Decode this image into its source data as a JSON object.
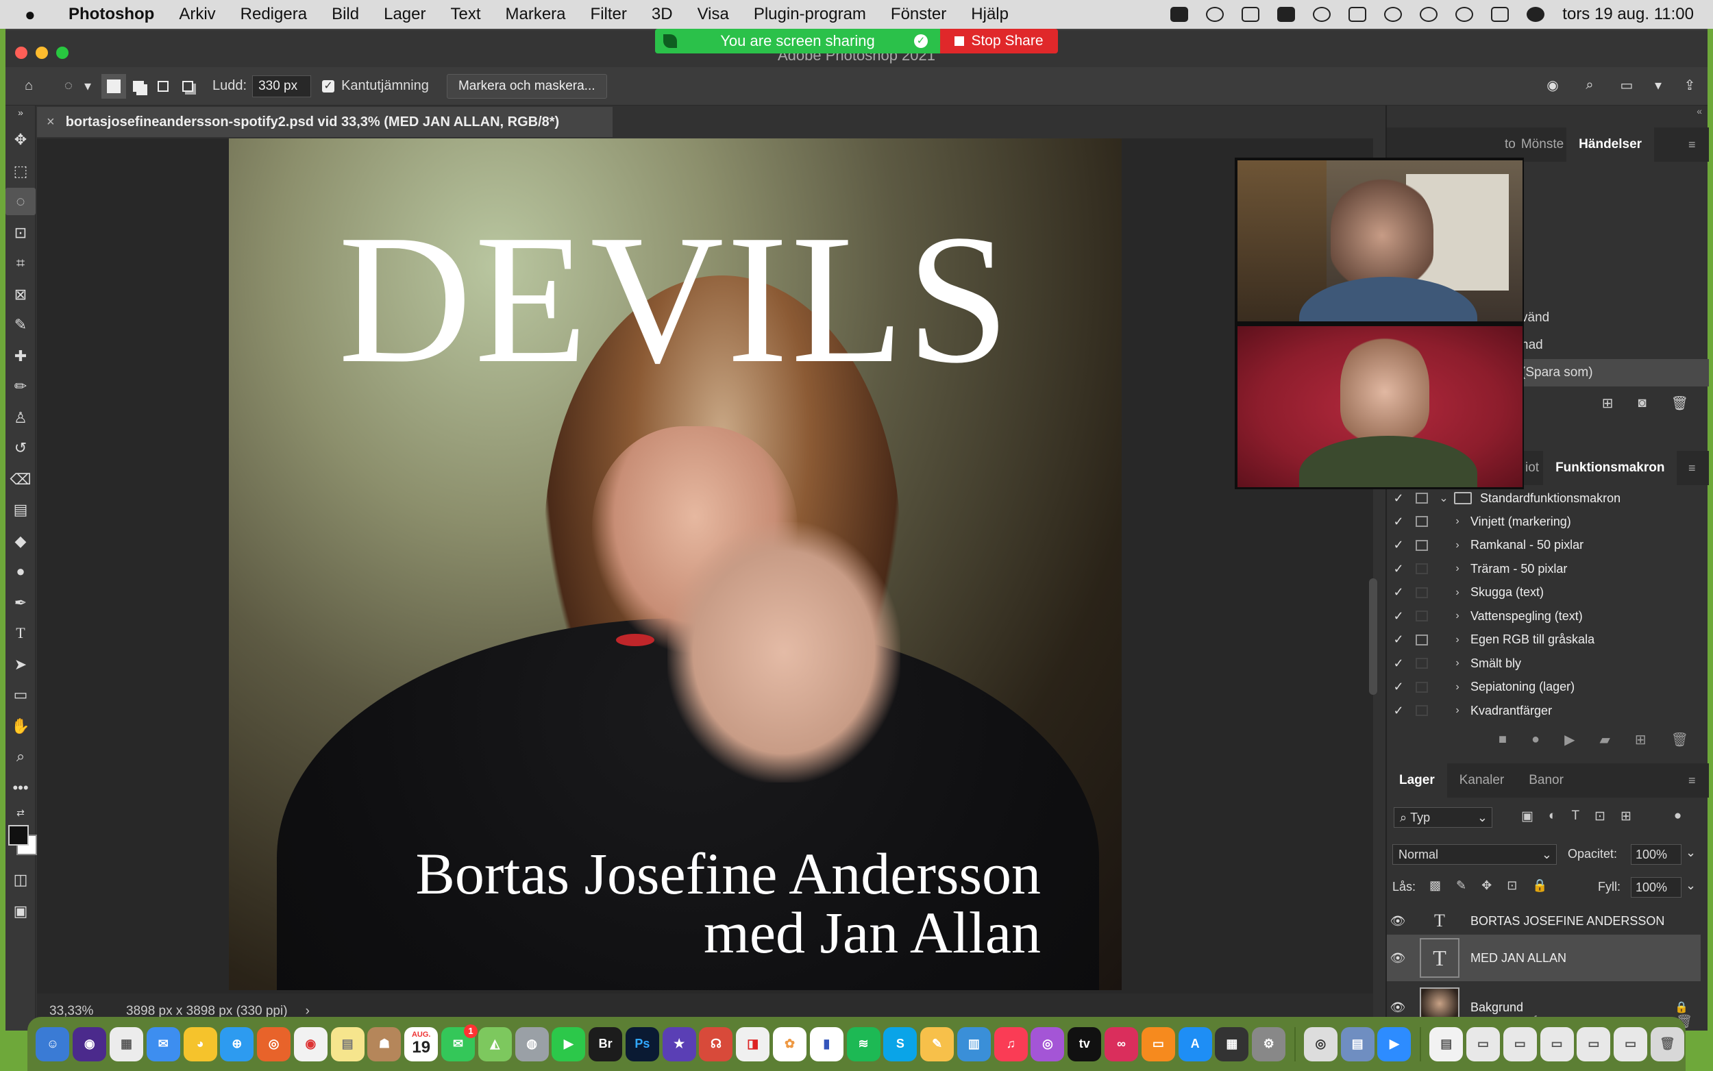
{
  "menubar": {
    "app_name": "Photoshop",
    "items": [
      "Arkiv",
      "Redigera",
      "Bild",
      "Lager",
      "Text",
      "Markera",
      "Filter",
      "3D",
      "Visa",
      "Plugin-program",
      "Fönster",
      "Hjälp"
    ],
    "clock": "tors 19 aug.  11:00"
  },
  "window": {
    "title": "Adobe Photoshop 2021"
  },
  "screenshare": {
    "status_text": "You are screen sharing",
    "stop_label": "Stop Share"
  },
  "options": {
    "feather_label": "Ludd:",
    "feather_value": "330 px",
    "antialias_label": "Kantutjämning",
    "antialias_checked": true,
    "select_mask_label": "Markera och maskera..."
  },
  "document": {
    "tab_title": "bortasjosefineandersson-spotify2.psd vid 33,3% (MED JAN ALLAN, RGB/8*)",
    "close_glyph": "×",
    "zoom": "33,33%",
    "size_info": "3898 px x 3898 px (330 ppi)"
  },
  "artwork": {
    "title": "DEVILS",
    "line1": "Bortas Josefine Andersson",
    "line2": "med Jan Allan"
  },
  "history_panel": {
    "tabs": [
      "to",
      "Mönste",
      "Händelser"
    ],
    "active_tab": "Händelser",
    "rows": [
      "vänd",
      "nad",
      "(Spara som)"
    ]
  },
  "actions_panel": {
    "tabs": [
      "iot",
      "Funktionsmakron"
    ],
    "active_tab": "Funktionsmakron",
    "set_name": "Standardfunktionsmakron",
    "actions": [
      {
        "name": "Vinjett (markering)",
        "dialog": true
      },
      {
        "name": "Ramkanal - 50 pixlar",
        "dialog": true
      },
      {
        "name": "Träram - 50 pixlar",
        "dialog": false
      },
      {
        "name": "Skugga (text)",
        "dialog": false
      },
      {
        "name": "Vattenspegling (text)",
        "dialog": false
      },
      {
        "name": "Egen RGB till gråskala",
        "dialog": true
      },
      {
        "name": "Smält bly",
        "dialog": false
      },
      {
        "name": "Sepiatoning (lager)",
        "dialog": false
      },
      {
        "name": "Kvadrantfärger",
        "dialog": false
      }
    ]
  },
  "layers_panel": {
    "tabs": [
      "Lager",
      "Kanaler",
      "Banor"
    ],
    "active_tab": "Lager",
    "filter_label": "Typ",
    "blend_mode": "Normal",
    "opacity_label": "Opacitet:",
    "opacity_value": "100%",
    "lock_label": "Lås:",
    "fill_label": "Fyll:",
    "fill_value": "100%",
    "layers": [
      {
        "name": "BORTAS JOSEFINE ANDERSSON",
        "type": "text"
      },
      {
        "name": "MED JAN ALLAN",
        "type": "text",
        "selected": true
      },
      {
        "name": "Bakgrund",
        "type": "image",
        "locked": true
      }
    ]
  },
  "dock": {
    "calendar_day": "19",
    "calendar_month": "AUG.",
    "messages_badge": "1",
    "bridge_label": "Br",
    "photoshop_label": "Ps",
    "skype_label": "S",
    "tv_label": "tv"
  },
  "colors": {
    "accent_green": "#2bc14a",
    "stop_red": "#e0282a",
    "desktop_green": "#6ea83a"
  }
}
